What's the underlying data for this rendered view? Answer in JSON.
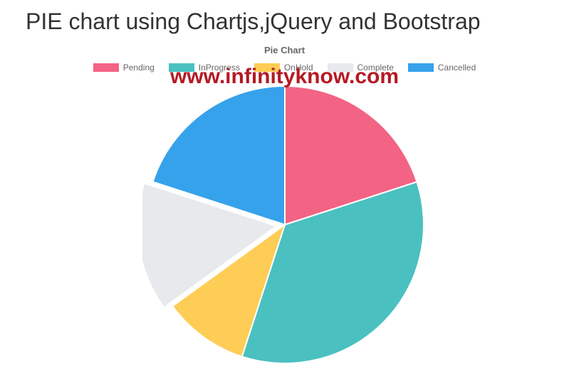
{
  "page_title": "PIE chart using Chartjs,jQuery and Bootstrap",
  "watermark": "www.infinityknow.com",
  "chart_data": {
    "type": "pie",
    "title": "Pie Chart",
    "series": [
      {
        "name": "Pending",
        "value": 20,
        "color": "#f36384"
      },
      {
        "name": "InProgress",
        "value": 35,
        "color": "#4bc0c0"
      },
      {
        "name": "OnHold",
        "value": 10,
        "color": "#fecd56"
      },
      {
        "name": "Complete",
        "value": 15,
        "color": "#e7e9ed"
      },
      {
        "name": "Cancelled",
        "value": 20,
        "color": "#36a2eb"
      }
    ]
  }
}
